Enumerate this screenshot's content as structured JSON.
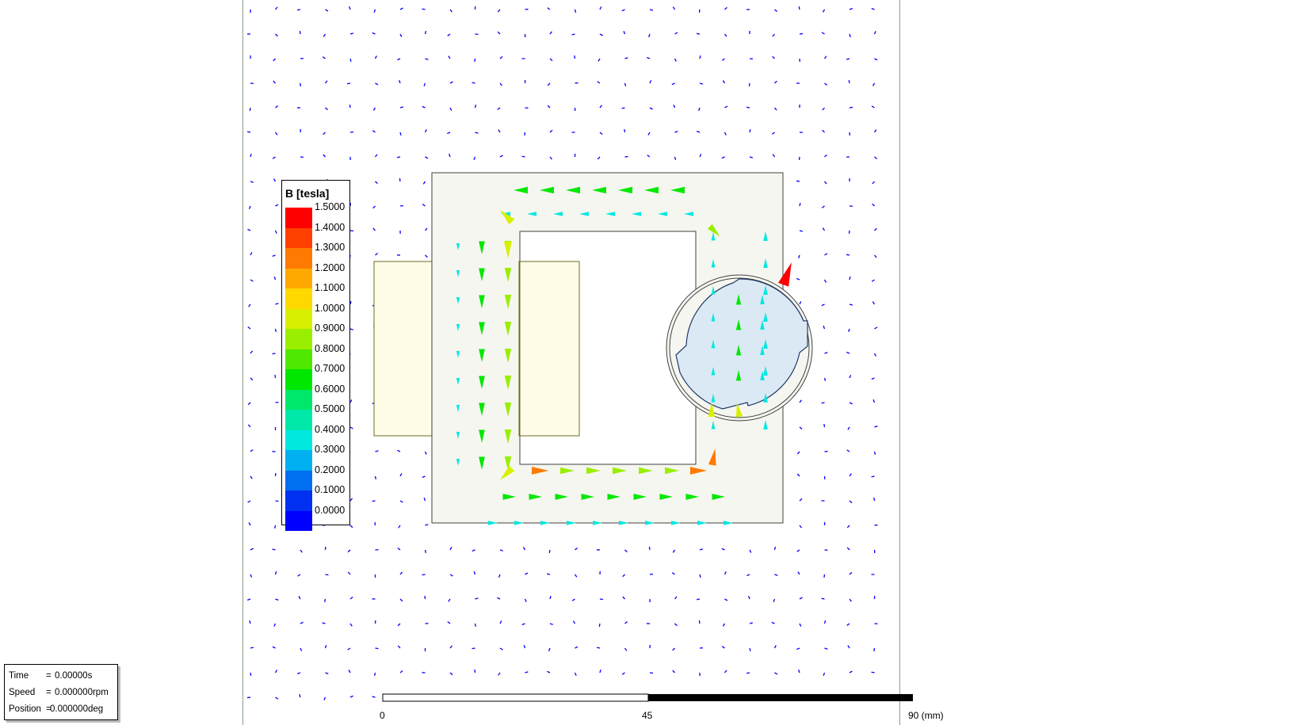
{
  "legend": {
    "title": "B [tesla]",
    "entries": [
      {
        "value": "1.5000",
        "color": "#ff0000"
      },
      {
        "value": "1.4000",
        "color": "#ff4000"
      },
      {
        "value": "1.3000",
        "color": "#ff7a00"
      },
      {
        "value": "1.2000",
        "color": "#ffa800"
      },
      {
        "value": "1.1000",
        "color": "#ffd800"
      },
      {
        "value": "1.0000",
        "color": "#d8f000"
      },
      {
        "value": "0.9000",
        "color": "#9aee00"
      },
      {
        "value": "0.8000",
        "color": "#4ee800"
      },
      {
        "value": "0.7000",
        "color": "#00e800"
      },
      {
        "value": "0.6000",
        "color": "#00e86a"
      },
      {
        "value": "0.5000",
        "color": "#00e8a8"
      },
      {
        "value": "0.4000",
        "color": "#00e8e0"
      },
      {
        "value": "0.3000",
        "color": "#00b0f0"
      },
      {
        "value": "0.2000",
        "color": "#0070f0"
      },
      {
        "value": "0.1000",
        "color": "#0030f0"
      },
      {
        "value": "0.0000",
        "color": "#0000ff"
      }
    ]
  },
  "info": {
    "time_label": "Time",
    "time_value": "0.00000s",
    "speed_label": "Speed",
    "speed_value": "0.000000rpm",
    "position_label": "Position",
    "position_value": "0.000000deg"
  },
  "scale_bar": {
    "labels": [
      "0",
      "45",
      "90 (mm)"
    ]
  },
  "colors": {
    "field_arrow_low": "#0000ff",
    "core_fill": "#f6f6f0",
    "coil_fill": "#fffde8",
    "rotor_fill": "#dbe9f4",
    "accent_high": "#ff0000"
  }
}
